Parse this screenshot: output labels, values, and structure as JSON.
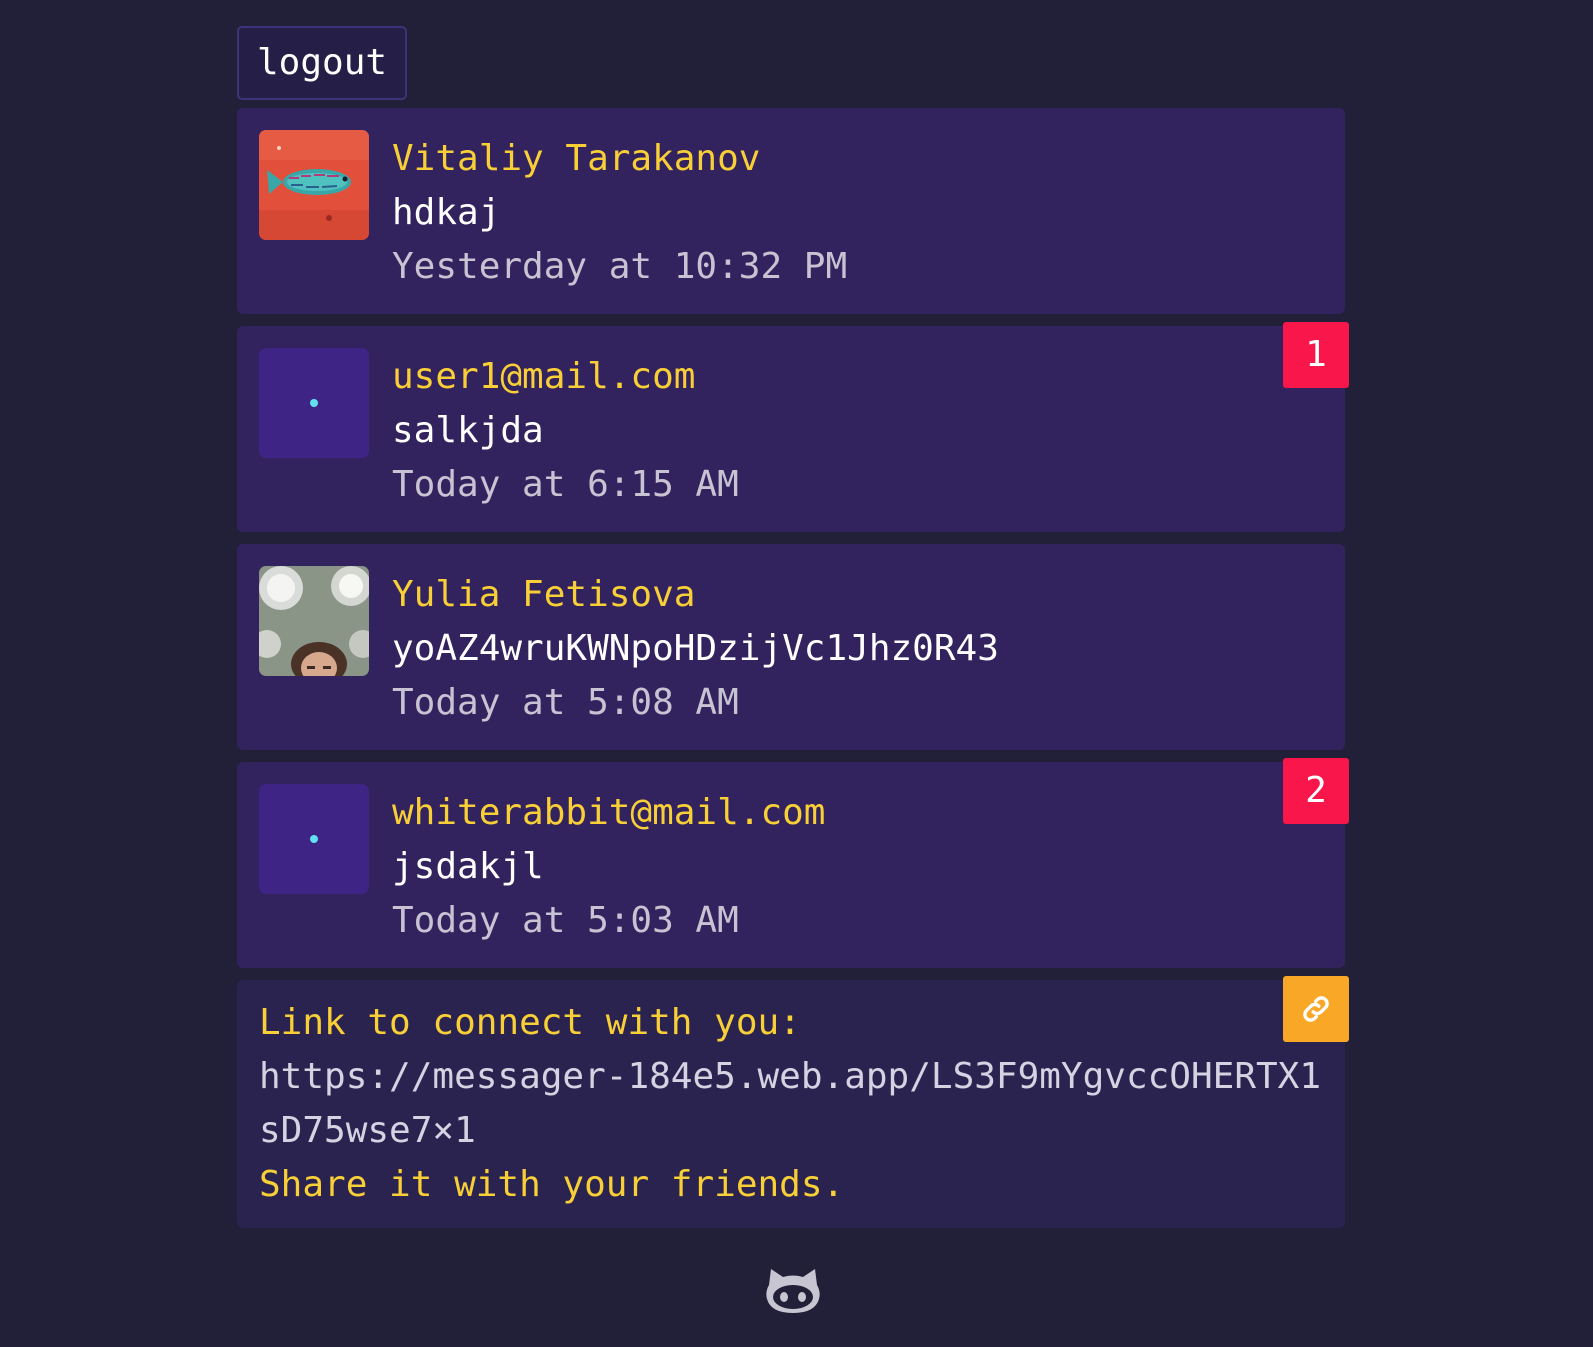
{
  "header": {
    "logout_label": "logout"
  },
  "chats": [
    {
      "name": "Vitaliy Tarakanov",
      "last_message": "hdkaj",
      "time": "Yesterday at 10:32 PM",
      "avatar": "photo-fish",
      "unread": null
    },
    {
      "name": "user1@mail.com",
      "last_message": "salkjda",
      "time": "Today at 6:15 AM",
      "avatar": "placeholder",
      "unread": "1"
    },
    {
      "name": "Yulia Fetisova",
      "last_message": "yoAZ4wruKWNpoHDzijVc1Jhz0R43",
      "time": "Today at 5:08 AM",
      "avatar": "photo-person",
      "unread": null
    },
    {
      "name": "whiterabbit@mail.com",
      "last_message": "jsdakjl",
      "time": "Today at 5:03 AM",
      "avatar": "placeholder",
      "unread": "2"
    }
  ],
  "invite": {
    "title": "Link to connect with you:",
    "url": "https://messager-184e5.web.app/LS3F9mYgvccOHERTX1sD75wse7×1",
    "share_text": "Share it with your friends.",
    "copy_icon": "link-icon"
  },
  "footer": {
    "icon": "github-icon"
  },
  "colors": {
    "background": "#221f39",
    "card": "#32225e",
    "accent_yellow": "#f8cf36",
    "badge_red": "#f8164a",
    "copy_orange": "#f9a727"
  }
}
